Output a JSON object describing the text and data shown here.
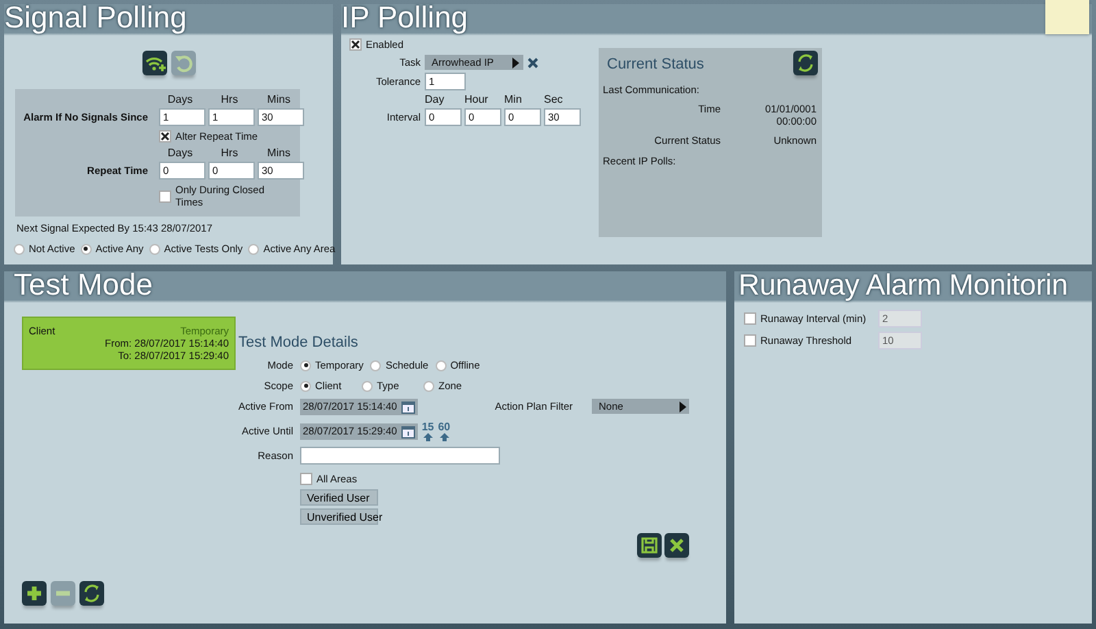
{
  "signal_polling": {
    "title": "Signal Polling",
    "toolbar": [
      {
        "kind": "wifi_add",
        "disabled": false
      },
      {
        "kind": "undo",
        "disabled": true
      }
    ],
    "alarm": {
      "label": "Alarm If No Signals Since",
      "columns": [
        "Days",
        "Hrs",
        "Mins"
      ],
      "values": [
        "1",
        "1",
        "30"
      ]
    },
    "alter_repeat": {
      "label": "Alter Repeat Time",
      "checked": true
    },
    "repeat": {
      "label": "Repeat Time",
      "columns": [
        "Days",
        "Hrs",
        "Mins"
      ],
      "values": [
        "0",
        "0",
        "30"
      ]
    },
    "closed_times": {
      "label": "Only During Closed Times",
      "checked": false
    },
    "next_signal": "Next Signal Expected By 15:43 28/07/2017",
    "modes": [
      {
        "label": "Not Active",
        "selected": false
      },
      {
        "label": "Active Any",
        "selected": true
      },
      {
        "label": "Active Tests Only",
        "selected": false
      },
      {
        "label": "Active Any Area",
        "selected": false
      }
    ]
  },
  "ip_polling": {
    "title": "IP Polling",
    "enabled": {
      "label": "Enabled",
      "checked": true
    },
    "task": {
      "label": "Task",
      "value": "Arrowhead IP"
    },
    "tolerance": {
      "label": "Tolerance",
      "value": "1"
    },
    "interval": {
      "label": "Interval",
      "columns": [
        "Day",
        "Hour",
        "Min",
        "Sec"
      ],
      "values": [
        "0",
        "0",
        "0",
        "30"
      ]
    },
    "current_status": {
      "title": "Current Status",
      "last_communication": "Last Communication:",
      "rows": [
        {
          "label": "Time",
          "value": "01/01/0001 00:00:00"
        },
        {
          "label": "Current Status",
          "value": "Unknown"
        }
      ],
      "recent": "Recent IP Polls:"
    }
  },
  "test_mode": {
    "title": "Test Mode",
    "entries": [
      {
        "name": "Client",
        "mode": "Temporary",
        "from": "From: 28/07/2017 15:14:40",
        "to": "To: 28/07/2017 15:29:40"
      }
    ],
    "details": {
      "title": "Test Mode Details",
      "mode": {
        "label": "Mode",
        "options": [
          {
            "label": "Temporary",
            "selected": true
          },
          {
            "label": "Schedule",
            "selected": false
          },
          {
            "label": "Offline",
            "selected": false
          }
        ]
      },
      "scope": {
        "label": "Scope",
        "options": [
          {
            "label": "Client",
            "selected": true
          },
          {
            "label": "Type",
            "selected": false
          },
          {
            "label": "Zone",
            "selected": false
          }
        ]
      },
      "active_from": {
        "label": "Active From",
        "value": "28/07/2017 15:14:40"
      },
      "active_until": {
        "label": "Active Until",
        "value": "28/07/2017 15:29:40"
      },
      "quick_extend": [
        "15",
        "60"
      ],
      "action_plan_filter": {
        "label": "Action Plan Filter",
        "value": "None"
      },
      "reason": {
        "label": "Reason"
      },
      "all_areas": {
        "label": "All Areas",
        "checked": false
      },
      "user_buttons": [
        "Verified User",
        "Unverified User"
      ]
    },
    "toolbar": [
      {
        "kind": "add",
        "disabled": false
      },
      {
        "kind": "remove",
        "disabled": true
      },
      {
        "kind": "refresh",
        "disabled": false
      }
    ]
  },
  "runaway": {
    "title": "Runaway Alarm Monitorin",
    "rows": [
      {
        "label": "Runaway Interval (min)",
        "checked": false,
        "value": "2",
        "disabled": true
      },
      {
        "label": "Runaway Threshold",
        "checked": false,
        "value": "10",
        "disabled": true
      }
    ]
  }
}
